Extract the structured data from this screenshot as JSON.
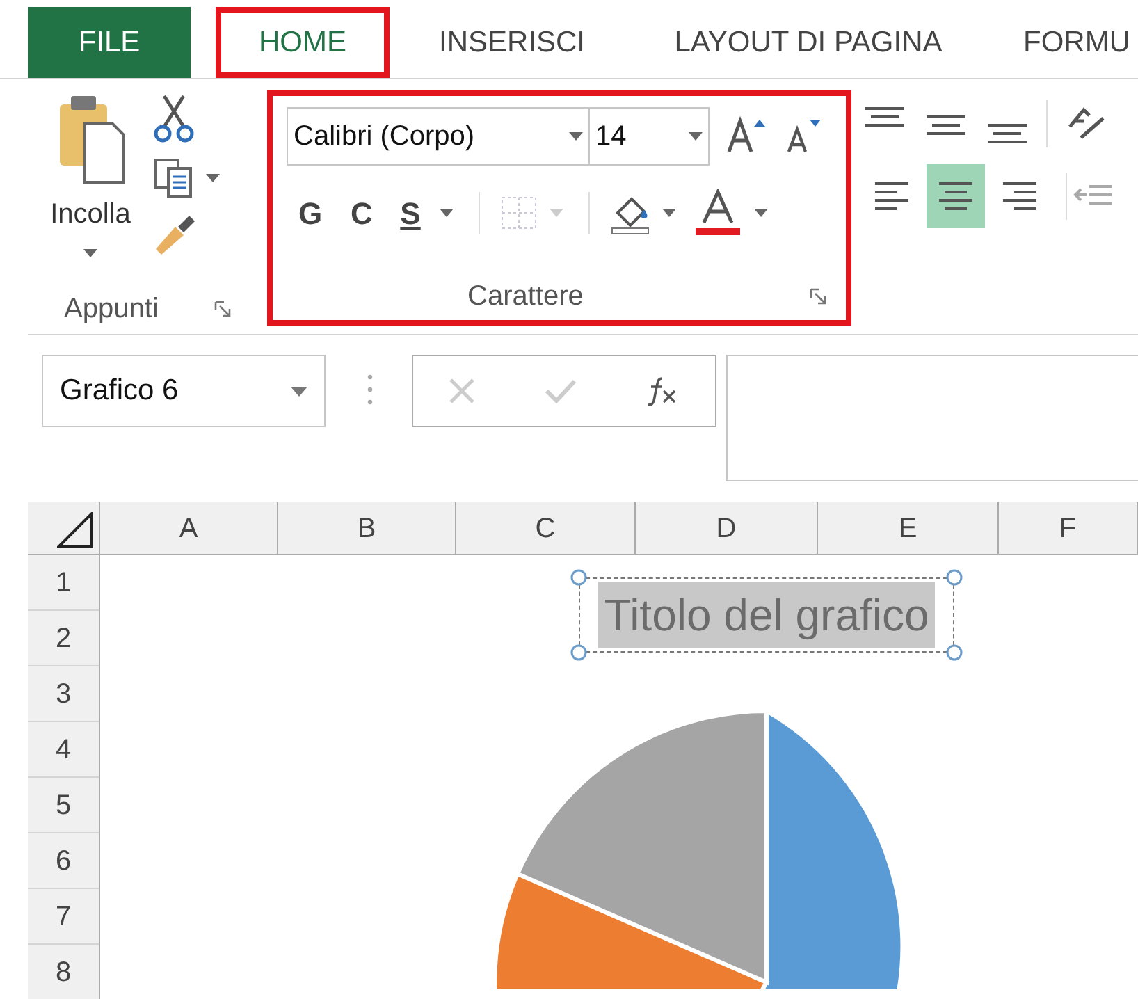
{
  "tabs": [
    {
      "label": "FILE",
      "kind": "file",
      "selected": false,
      "highlighted": false
    },
    {
      "label": "HOME",
      "kind": "tab",
      "selected": true,
      "highlighted": true
    },
    {
      "label": "INSERISCI",
      "kind": "tab",
      "selected": false,
      "highlighted": false
    },
    {
      "label": "LAYOUT DI PAGINA",
      "kind": "tab",
      "selected": false,
      "highlighted": false
    },
    {
      "label": "FORMU",
      "kind": "tab",
      "selected": false,
      "highlighted": false
    }
  ],
  "clipboard": {
    "paste_label": "Incolla",
    "group_label": "Appunti"
  },
  "font_group": {
    "font_name": "Calibri (Corpo)",
    "font_size": "14",
    "bold_label": "G",
    "italic_label": "C",
    "underline_label": "S",
    "group_label": "Carattere",
    "highlighted": true
  },
  "alignment": [
    {
      "kind": "left",
      "selected": false
    },
    {
      "kind": "center",
      "selected": true
    },
    {
      "kind": "right",
      "selected": false
    }
  ],
  "formula_bar": {
    "name_box": "Grafico 6"
  },
  "sheet": {
    "columns": [
      "A",
      "B",
      "C",
      "D",
      "E",
      "F"
    ],
    "rows": [
      "1",
      "2",
      "3",
      "4",
      "5",
      "6",
      "7",
      "8"
    ]
  },
  "chart": {
    "title": "Titolo del grafico",
    "title_selected": true
  }
}
